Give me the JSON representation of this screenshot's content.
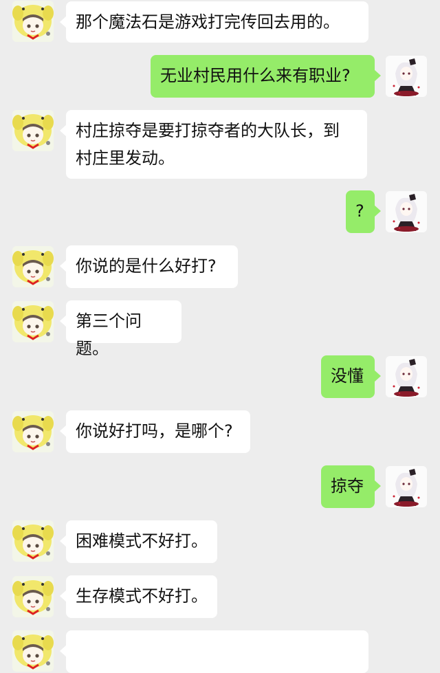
{
  "messages": [
    {
      "side": "left",
      "text": "那个魔法石是游戏打完传回去用的。"
    },
    {
      "side": "right",
      "text": "无业村民用什么来有职业?"
    },
    {
      "side": "left",
      "text": "村庄掠夺是要打掠夺者的大队长，到\n村庄里发动。"
    },
    {
      "side": "right",
      "text": "?"
    },
    {
      "side": "left",
      "text": "你说的是什么好打?"
    },
    {
      "side": "left",
      "text": "第三个问题。"
    },
    {
      "side": "right",
      "text": "没懂"
    },
    {
      "side": "left",
      "text": "你说好打吗，是哪个?"
    },
    {
      "side": "right",
      "text": "掠夺"
    },
    {
      "side": "left",
      "text": "困难模式不好打。"
    },
    {
      "side": "left",
      "text": "生存模式不好打。"
    },
    {
      "side": "left",
      "text": ""
    }
  ],
  "avatars": {
    "left": "yellow-dog-hood-girl-avatar",
    "right": "white-hair-gothic-girl-avatar"
  },
  "colors": {
    "background": "#ededed",
    "incoming_bubble": "#ffffff",
    "outgoing_bubble": "#95ec69"
  }
}
